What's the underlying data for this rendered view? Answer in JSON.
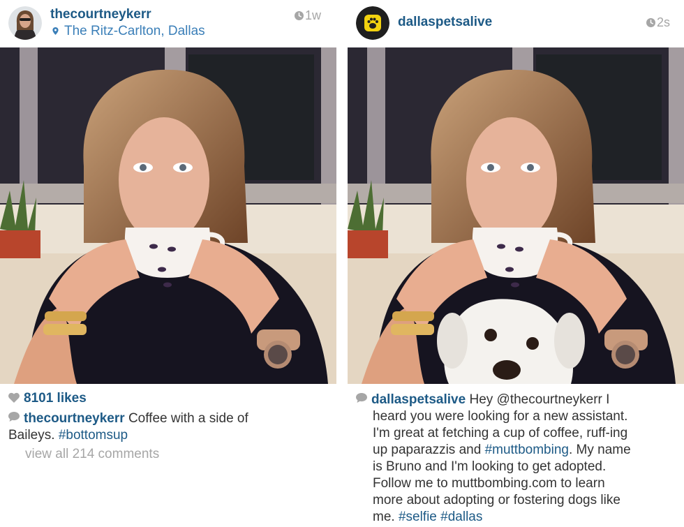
{
  "posts": [
    {
      "username": "thecourtneykerr",
      "location": "The Ritz-Carlton, Dallas",
      "time": "1w",
      "likes": "8101 likes",
      "caption_user": "thecourtneykerr",
      "caption_text_1": " Coffee with a side of",
      "caption_text_2": "Baileys. ",
      "caption_tag": "#bottomsup",
      "comments": "view all 214 comments"
    },
    {
      "username": "dallaspetsalive",
      "time": "2s",
      "caption_user": "dallaspetsalive",
      "caption_lines": [
        "   Hey @thecourtneykerr I",
        "heard you were looking for a new assistant.",
        "I'm great at fetching a cup of coffee, ruff-ing",
        "up paparazzis and ",
        "is Bruno and I'm looking to get adopted.",
        "Follow me to muttbombing.com to learn",
        "more about adopting or fostering dogs like",
        "me. "
      ],
      "caption_tag_1": "#muttbombing",
      "caption_after_tag_1": ". My name",
      "caption_tag_2": "#selfie",
      "caption_tag_3": "#dallas"
    }
  ],
  "colors": {
    "username_blue": "#1d5a86",
    "location_blue": "#3b7fb8",
    "muted_gray": "#a6a6a6",
    "logo_yellow": "#f2d20f"
  },
  "icons": [
    "location-pin-icon",
    "clock-icon",
    "heart-icon",
    "comment-icon",
    "paw-icon"
  ]
}
